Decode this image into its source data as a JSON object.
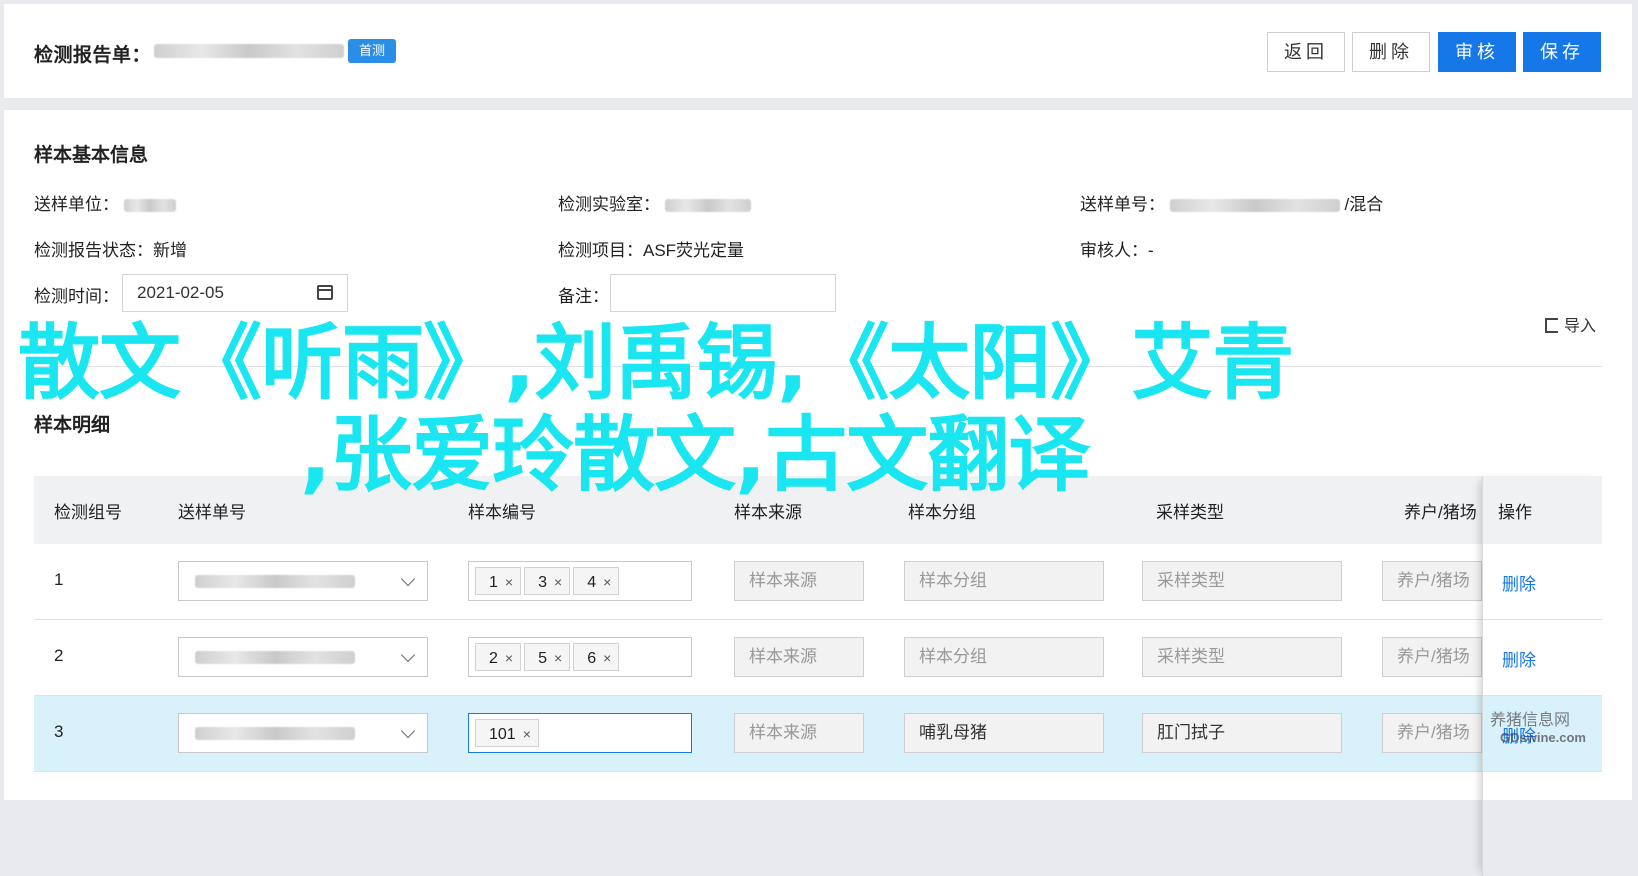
{
  "header": {
    "title": "检测报告单：",
    "badge": "首测",
    "buttons": {
      "back": "返回",
      "delete": "删除",
      "review": "审核",
      "save": "保存"
    }
  },
  "basic_info": {
    "title": "样本基本信息",
    "send_unit_label": "送样单位：",
    "lab_label": "检测实验室：",
    "send_no_label": "送样单号：",
    "send_no_suffix": "/混合",
    "report_status_label": "检测报告状态：",
    "report_status_value": "新增",
    "item_label": "检测项目：",
    "item_value": "ASF荧光定量",
    "reviewer_label": "审核人：",
    "reviewer_value": "-",
    "time_label": "检测时间：",
    "time_value": "2021-02-05",
    "note_label": "备注：",
    "note_value": ""
  },
  "detail": {
    "title": "样本明细",
    "import_label": "导入",
    "columns": [
      "检测组号",
      "送样单号",
      "样本编号",
      "样本来源",
      "样本分组",
      "采样类型",
      "养户/猪场",
      "操作"
    ],
    "rows": [
      {
        "no": "1",
        "tags": [
          "1",
          "3",
          "4"
        ],
        "source": "样本来源",
        "group": "样本分组",
        "type": "采样类型",
        "farm": "养户/猪场",
        "op": "删除",
        "selected": false
      },
      {
        "no": "2",
        "tags": [
          "2",
          "5",
          "6"
        ],
        "source": "样本来源",
        "group": "样本分组",
        "type": "采样类型",
        "farm": "养户/猪场",
        "op": "删除",
        "selected": false
      },
      {
        "no": "3",
        "tags": [
          "101"
        ],
        "source": "样本来源",
        "group": "哺乳母猪",
        "type": "肛门拭子",
        "farm": "养户/猪场",
        "op": "删除",
        "selected": true
      }
    ]
  },
  "overlay": {
    "line1": "散文《听雨》,刘禹锡,《太阳》艾青",
    "line2": ",张爱玲散文,古文翻译"
  },
  "watermark": {
    "text1": "养猪信息网",
    "text2": "GDswine.com"
  },
  "colors": {
    "primary": "#1677e8",
    "badge": "#2a8de6",
    "overlay": "#19e6f0",
    "selected_row": "#d9f1fb"
  }
}
